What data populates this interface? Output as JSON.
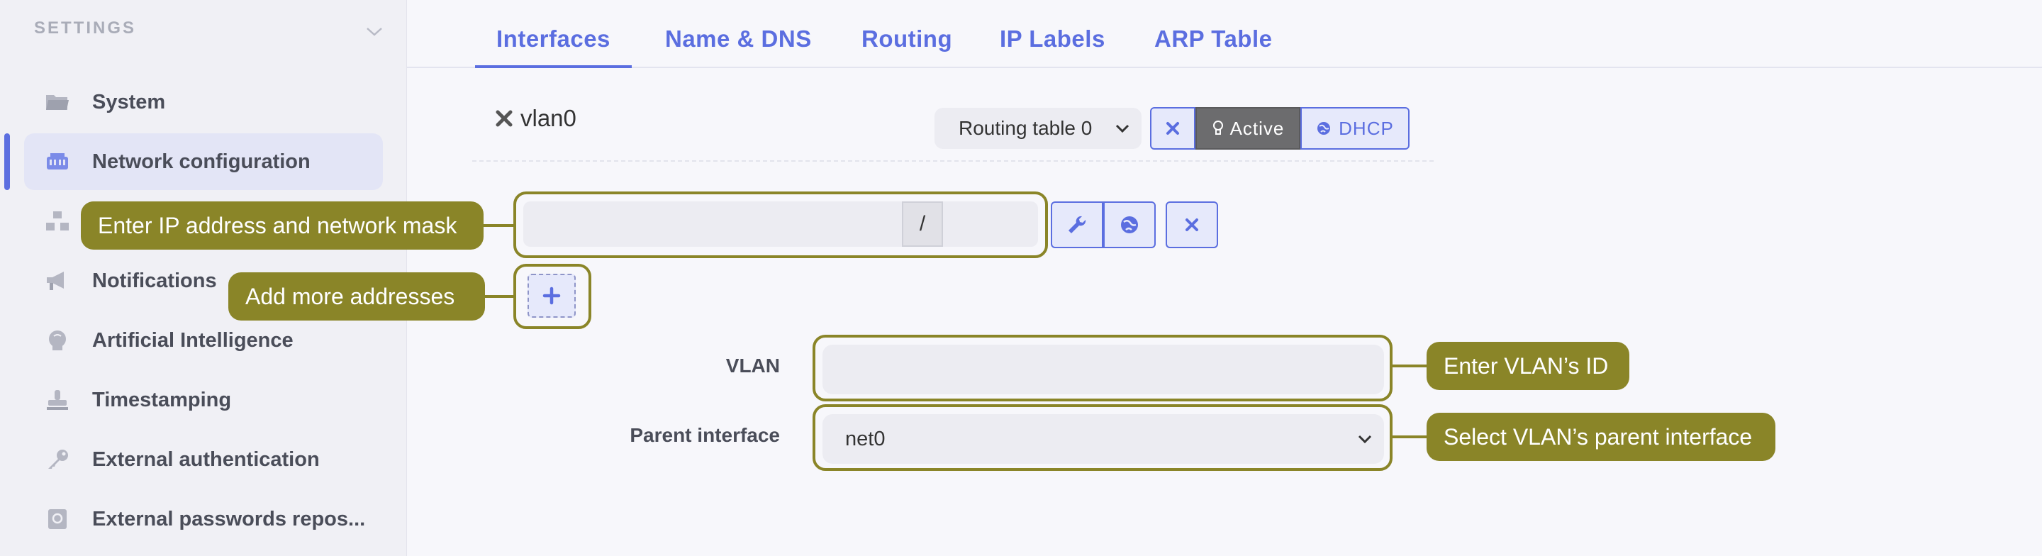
{
  "sidebar": {
    "heading": "SETTINGS",
    "items": [
      {
        "label": "System",
        "icon": "folder-icon"
      },
      {
        "label": "Network configuration",
        "icon": "network-icon"
      },
      {
        "label": "",
        "icon": "hierarchy-icon"
      },
      {
        "label": "Notifications",
        "icon": "megaphone-icon"
      },
      {
        "label": "Artificial Intelligence",
        "icon": "brain-icon"
      },
      {
        "label": "Timestamping",
        "icon": "stamp-icon"
      },
      {
        "label": "External authentication",
        "icon": "key-icon"
      },
      {
        "label": "External passwords repos...",
        "icon": "safe-icon"
      }
    ]
  },
  "tabs": [
    {
      "label": "Interfaces",
      "active": true
    },
    {
      "label": "Name & DNS"
    },
    {
      "label": "Routing"
    },
    {
      "label": "IP Labels"
    },
    {
      "label": "ARP Table"
    }
  ],
  "interface": {
    "name": "vlan0",
    "routing_table": "Routing table 0",
    "active_label": "Active",
    "dhcp_label": "DHCP"
  },
  "address": {
    "slash": "/",
    "ip_value": "",
    "mask_value": ""
  },
  "form": {
    "vlan_label": "VLAN",
    "vlan_value": "",
    "parent_label": "Parent interface",
    "parent_value": "net0"
  },
  "callouts": {
    "ip": "Enter IP address and network mask",
    "add": "Add more addresses",
    "vlan": "Enter VLAN’s ID",
    "parent": "Select VLAN’s parent interface"
  },
  "colors": {
    "accent": "#5b6ee0",
    "callout": "#8a8528",
    "active_button": "#6c6c6e"
  }
}
